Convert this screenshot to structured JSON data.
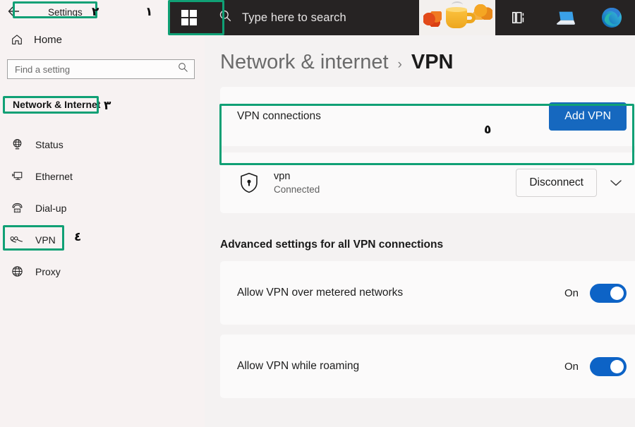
{
  "taskbar": {
    "start_icon": "windows-logo-icon",
    "search_icon": "search-icon",
    "search_placeholder": "Type here to search",
    "mug_icon": "coffee-mug-autumn-leaves-icon",
    "taskview_icon": "task-view-icon",
    "laptop_icon": "laptop-app-icon",
    "edge_icon": "microsoft-edge-icon"
  },
  "sidebar": {
    "back_label": "←",
    "title": "Settings",
    "home_icon": "home-icon",
    "home_label": "Home",
    "search_placeholder": "Find a setting",
    "search_value": "",
    "search_icon": "search-icon",
    "section_label": "Network & Internet",
    "items": [
      {
        "label": "Status",
        "icon": "globe-signal-icon",
        "selected": false
      },
      {
        "label": "Ethernet",
        "icon": "monitor-icon",
        "selected": false
      },
      {
        "label": "Dial-up",
        "icon": "telephone-icon",
        "selected": false
      },
      {
        "label": "VPN",
        "icon": "vpn-connector-icon",
        "selected": true
      },
      {
        "label": "Proxy",
        "icon": "globe-icon",
        "selected": false
      }
    ]
  },
  "main": {
    "breadcrumb_parent": "Network & internet",
    "breadcrumb_separator": "›",
    "breadcrumb_current": "VPN",
    "vpn_connections_label": "VPN connections",
    "add_vpn_label": "Add VPN",
    "connection": {
      "icon": "shield-lock-icon",
      "name": "vpn",
      "status": "Connected",
      "action_label": "Disconnect",
      "expand_icon": "chevron-down-icon"
    },
    "advanced_title": "Advanced settings for all VPN connections",
    "toggles": [
      {
        "label": "Allow VPN over metered networks",
        "state": "On",
        "on": true
      },
      {
        "label": "Allow VPN while roaming",
        "state": "On",
        "on": true
      }
    ]
  },
  "annotations": {
    "highlight_color": "#10a075",
    "markers": [
      {
        "id": "marker-1",
        "text": "١"
      },
      {
        "id": "marker-2",
        "text": "٢"
      },
      {
        "id": "marker-3",
        "text": "٣"
      },
      {
        "id": "marker-4",
        "text": "٤"
      },
      {
        "id": "marker-5",
        "text": "٥"
      }
    ]
  },
  "colors": {
    "accent_blue": "#1668bf",
    "toggle_blue": "#0d63c6",
    "highlight_green": "#10a075",
    "taskbar_dark": "#262323"
  }
}
